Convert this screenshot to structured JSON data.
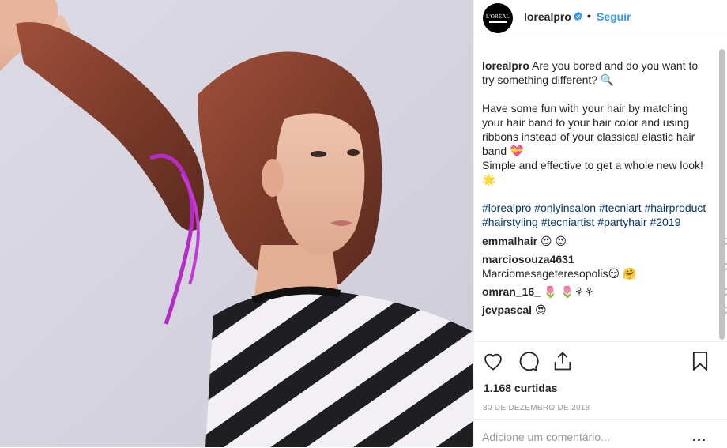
{
  "header": {
    "username": "lorealpro",
    "follow_label": "Seguir",
    "separator": "•",
    "avatar_text": "L'ORÉAL"
  },
  "caption": {
    "username": "lorealpro",
    "line1": "Are you bored and do you want to try something different? 🔍",
    "line2": "Have some fun with your hair by matching your hair band to your hair color and using ribbons instead of your classical elastic hair band 💝",
    "line3": "Simple and effective to get a whole new look! 🌟",
    "hashtags": [
      "#lorealpro",
      "#onlyinsalon",
      "#tecniart",
      "#hairproduct",
      "#hairstyling",
      "#tecniartist",
      "#partyhair",
      "#2019"
    ]
  },
  "comments": [
    {
      "username": "emmalhair",
      "text": "😍 😍"
    },
    {
      "username": "marciosouza4631",
      "text": "Marciomesageteresopolis😏 🤗"
    },
    {
      "username": "omran_16_",
      "text": "🌷 🌷⚘⚘"
    },
    {
      "username": "jcvpascal",
      "text": "😍"
    }
  ],
  "actions": {
    "likes": "1.168 curtidas",
    "date": "30 DE DEZEMBRO DE 2018"
  },
  "comment_box": {
    "placeholder": "Adicione um comentário...",
    "more_label": "..."
  },
  "icons": [
    "verified-icon",
    "heart-icon",
    "comment-icon",
    "share-icon",
    "bookmark-icon",
    "heart-small-icon",
    "more-options-icon"
  ],
  "colors": {
    "accent": "#3897f0",
    "hashtag": "#003569",
    "text": "#262626",
    "muted": "#999999"
  }
}
